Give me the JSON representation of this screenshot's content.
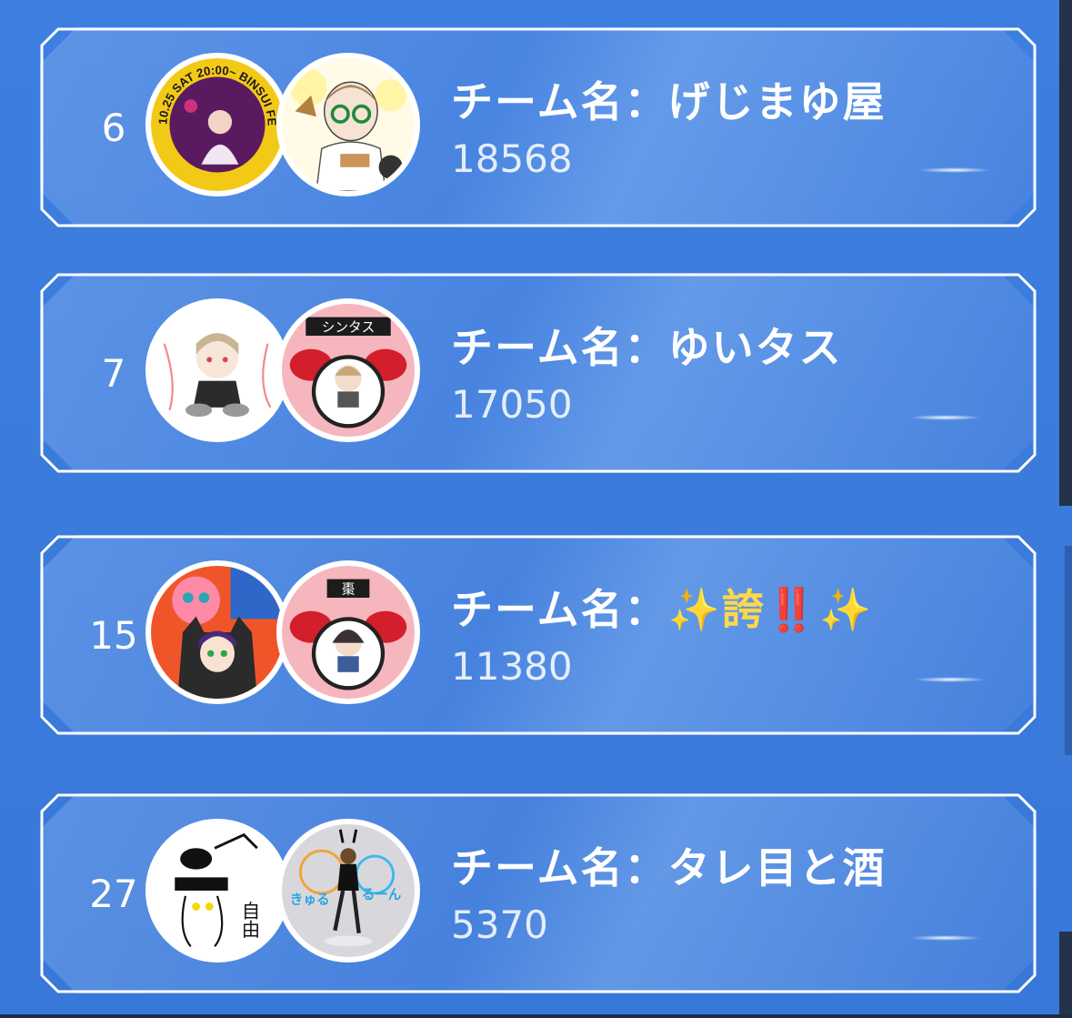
{
  "entries": [
    {
      "rank": "6",
      "team_label": "チーム名：げじまゆ屋",
      "score": "18568",
      "avatar1": {
        "name": "concert-flyer-avatar",
        "bg": "#5a1a60",
        "ring_text": "10.25 SAT 20:00~ BINSUI FES VOL"
      },
      "avatar2": {
        "name": "glasses-boy-avatar",
        "bg": "#fffbe6"
      }
    },
    {
      "rank": "7",
      "team_label": "チーム名：ゆいタス",
      "score": "17050",
      "avatar1": {
        "name": "drummer-sketch-avatar",
        "bg": "#ffffff"
      },
      "avatar2": {
        "name": "drum-kit-avatar",
        "bg": "#f6b6be",
        "banner_text": "シンタス"
      }
    },
    {
      "rank": "15",
      "team_label": "チーム名：",
      "team_label_emoji": "✨誇‼️✨",
      "score": "11380",
      "avatar1": {
        "name": "cat-hoodie-girl-avatar",
        "bg": "#f0552a"
      },
      "avatar2": {
        "name": "drum-kit-avatar",
        "bg": "#f6b6be",
        "banner_text": "棗"
      }
    },
    {
      "rank": "27",
      "team_label": "チーム名：タレ目と酒",
      "score": "5370",
      "avatar1": {
        "name": "doodle-avatar",
        "bg": "#ffffff",
        "text": "自由"
      },
      "avatar2": {
        "name": "bunny-figure-avatar",
        "bg": "#d8d8dc",
        "text_left": "きゅる",
        "text_right": "るーん"
      }
    }
  ],
  "colors": {
    "background": "#3a7bdc",
    "card_border": "#ffffff",
    "text": "#ffffff"
  }
}
